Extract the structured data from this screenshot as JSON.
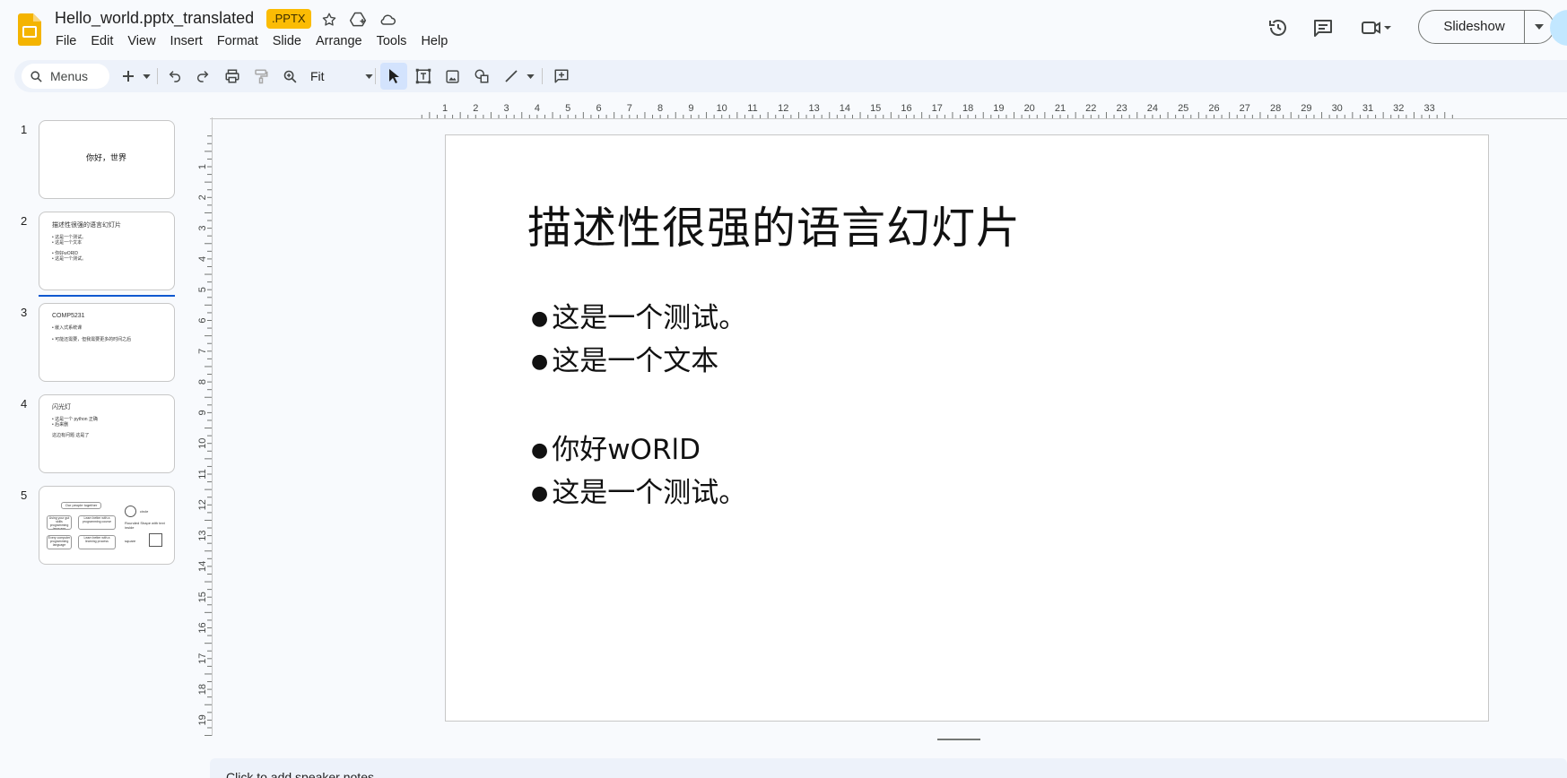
{
  "app": {
    "doc_title": "Hello_world.pptx_translated",
    "file_badge": ".PPTX",
    "logo_color": "#f4b400"
  },
  "menu": [
    "File",
    "Edit",
    "View",
    "Insert",
    "Format",
    "Slide",
    "Arrange",
    "Tools",
    "Help"
  ],
  "header_actions": {
    "slideshow_label": "Slideshow"
  },
  "toolbar": {
    "search_placeholder": "Menus",
    "zoom_value": "Fit"
  },
  "ruler": {
    "h_labels": [
      "1",
      "2",
      "3",
      "4",
      "5",
      "6",
      "7",
      "8",
      "9",
      "10",
      "11",
      "12",
      "13",
      "14",
      "15",
      "16",
      "17",
      "18",
      "19",
      "20",
      "21",
      "22",
      "23",
      "24",
      "25",
      "26",
      "27",
      "28",
      "29",
      "30",
      "31",
      "32",
      "33"
    ],
    "v_labels": [
      "1",
      "2",
      "3",
      "4",
      "5",
      "6",
      "7",
      "8",
      "9",
      "10",
      "11",
      "12",
      "13",
      "14",
      "15",
      "16",
      "17",
      "18",
      "19"
    ]
  },
  "filmstrip": [
    {
      "number": "1",
      "lines": [
        "你好，世界"
      ]
    },
    {
      "number": "2",
      "lines": [
        "描述性很强的语言幻灯片",
        "• 这是一个测试。",
        "• 这是一个文本",
        "• 你好wORlD",
        "• 这是一个测试。"
      ]
    },
    {
      "number": "3",
      "lines": [
        "COMP5231",
        "• 嵌入式系统课",
        "• 可能还需要，但我需要更多的时间之后"
      ]
    },
    {
      "number": "4",
      "lines": [
        "闪光灯",
        "• 这是一个 python 正确",
        "• 后来删",
        "这边有问题 这是了"
      ]
    },
    {
      "number": "5",
      "lines": [
        "Our people together",
        "Using your gut skills programming language",
        "Learn better with a programming course",
        "Every computer programming language",
        "Learn better with a learning process",
        "circle",
        "Rounded Shape with text inside",
        "square"
      ]
    }
  ],
  "slide": {
    "title": "描述性很强的语言幻灯片",
    "bullets": [
      "这是一个测试。",
      "这是一个文本",
      "你好wORlD",
      "这是一个测试。"
    ]
  },
  "notes": {
    "placeholder": "Click to add speaker notes"
  },
  "colors": {
    "accent": "#0b57d0",
    "badge": "#fbbc04",
    "toolbar_bg": "#edf2fa",
    "page_bg": "#f8fafd"
  }
}
